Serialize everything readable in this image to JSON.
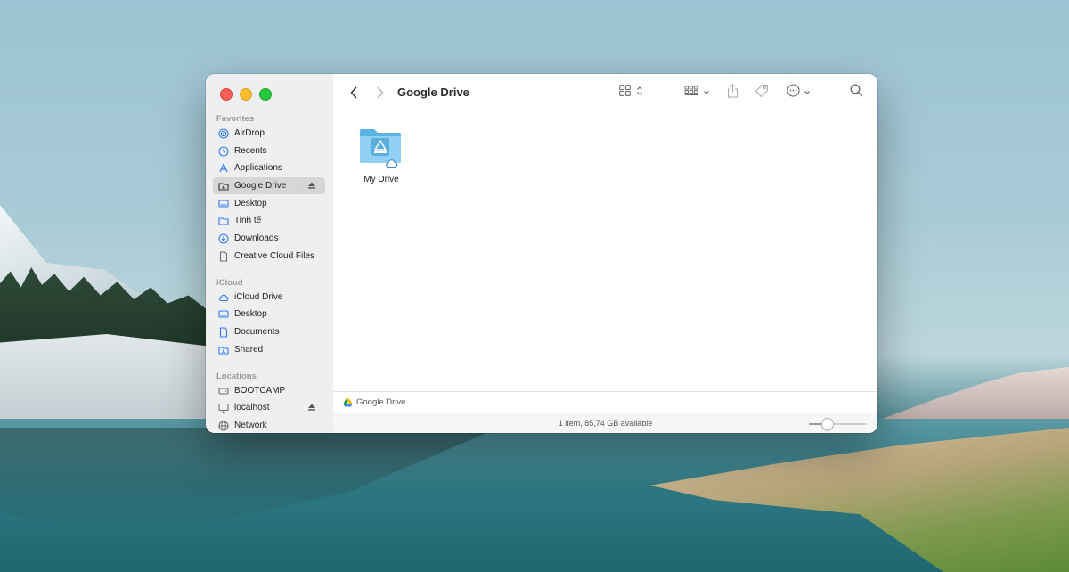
{
  "window": {
    "title": "Google Drive"
  },
  "sidebar": {
    "sections": [
      {
        "title": "Favorites",
        "items": [
          {
            "label": "AirDrop",
            "icon": "airdrop-icon"
          },
          {
            "label": "Recents",
            "icon": "clock-icon"
          },
          {
            "label": "Applications",
            "icon": "applications-icon"
          },
          {
            "label": "Google Drive",
            "icon": "drive-folder-icon",
            "selected": true,
            "ejectable": true
          },
          {
            "label": "Desktop",
            "icon": "desktop-icon"
          },
          {
            "label": "Tinh tế",
            "icon": "folder-icon"
          },
          {
            "label": "Downloads",
            "icon": "download-icon"
          },
          {
            "label": "Creative Cloud Files",
            "icon": "document-icon"
          }
        ]
      },
      {
        "title": "iCloud",
        "items": [
          {
            "label": "iCloud Drive",
            "icon": "cloud-icon"
          },
          {
            "label": "Desktop",
            "icon": "desktop-icon"
          },
          {
            "label": "Documents",
            "icon": "document-icon"
          },
          {
            "label": "Shared",
            "icon": "shared-folder-icon"
          }
        ]
      },
      {
        "title": "Locations",
        "items": [
          {
            "label": "BOOTCAMP",
            "icon": "disk-icon"
          },
          {
            "label": "localhost",
            "icon": "display-icon",
            "ejectable": true
          },
          {
            "label": "Network",
            "icon": "network-icon"
          }
        ]
      }
    ]
  },
  "content": {
    "items": [
      {
        "label": "My Drive",
        "icon": "google-drive-folder-icon",
        "cloud": true
      }
    ]
  },
  "pathbar": {
    "label": "Google Drive",
    "icon": "google-drive-logo-icon"
  },
  "statusbar": {
    "text": "1 item, 85,74 GB available",
    "zoom_level": 0.27
  },
  "colors": {
    "accent": "#3478f6",
    "folder": "#6fc0ee",
    "traffic_red": "#fe5f57",
    "traffic_yellow": "#febc2e",
    "traffic_green": "#28c840"
  }
}
